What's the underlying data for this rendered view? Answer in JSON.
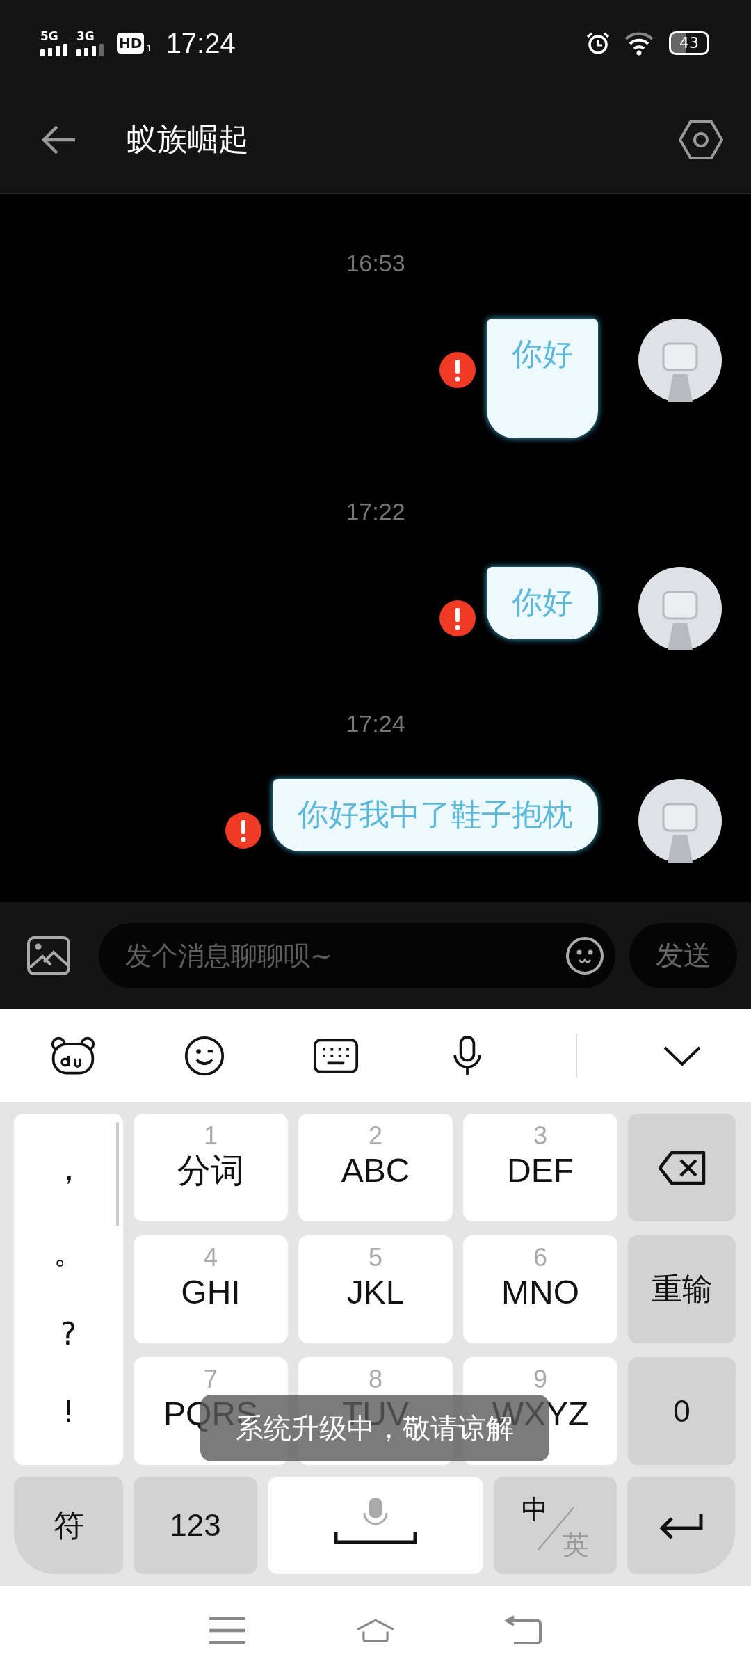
{
  "status_bar": {
    "network_1": "5G",
    "network_2": "3G",
    "hd": "HD",
    "hd_sub": "1",
    "time": "17:24",
    "battery": "43"
  },
  "header": {
    "title": "蚁族崛起"
  },
  "messages": [
    {
      "time": "16:53",
      "text": "你好",
      "failed": true,
      "tall": true
    },
    {
      "time": "17:22",
      "text": "你好",
      "failed": true,
      "tall": false
    },
    {
      "time": "17:24",
      "text": "你好我中了鞋子抱枕",
      "failed": true,
      "tall": false
    }
  ],
  "composer": {
    "placeholder": "发个消息聊聊呗~",
    "send": "发送"
  },
  "keyboard": {
    "punctuation": [
      "，",
      "。",
      "?",
      "!"
    ],
    "keys": [
      {
        "digit": "1",
        "letters": "分词"
      },
      {
        "digit": "2",
        "letters": "ABC"
      },
      {
        "digit": "3",
        "letters": "DEF"
      },
      {
        "digit": "4",
        "letters": "GHI"
      },
      {
        "digit": "5",
        "letters": "JKL"
      },
      {
        "digit": "6",
        "letters": "MNO"
      },
      {
        "digit": "7",
        "letters": "PQRS"
      },
      {
        "digit": "8",
        "letters": "TUV"
      },
      {
        "digit": "9",
        "letters": "WXYZ"
      }
    ],
    "side_keys": [
      {
        "kind": "backspace"
      },
      {
        "kind": "text",
        "label": "重输"
      },
      {
        "kind": "text",
        "label": "0"
      }
    ],
    "bottom_keys": [
      {
        "kind": "text",
        "label": "符"
      },
      {
        "kind": "text",
        "label": "123"
      },
      {
        "kind": "space"
      },
      {
        "kind": "lang",
        "label": "中",
        "alt": "英"
      },
      {
        "kind": "enter"
      }
    ]
  },
  "toast": "系统升级中，敬请谅解"
}
